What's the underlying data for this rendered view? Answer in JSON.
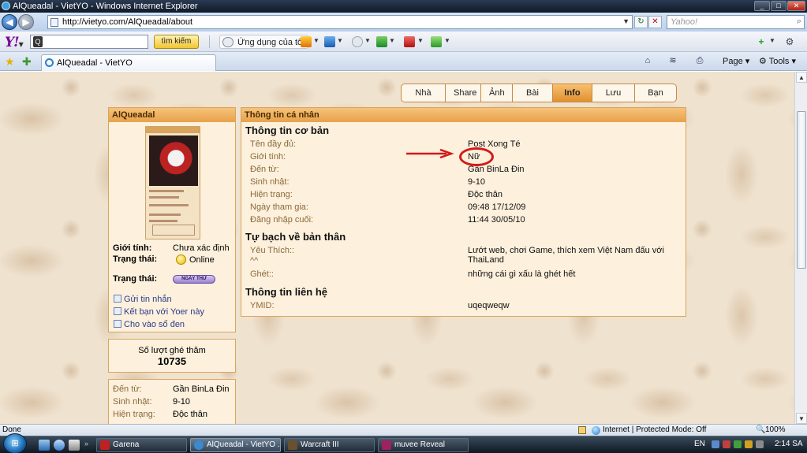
{
  "window": {
    "title": "AlQueadal - VietYO - Windows Internet Explorer"
  },
  "address": {
    "url": "http://vietyo.com/AlQueadal/about"
  },
  "search": {
    "placeholder": "Yahoo!"
  },
  "yahoo_toolbar": {
    "search_button": "tìm kiếm",
    "apps_label": "Ứng dụng của tôi"
  },
  "tab": {
    "title": "AlQueadal - VietYO"
  },
  "commands": {
    "page": "Page",
    "tools": "Tools"
  },
  "nav_tabs": [
    {
      "label": "Nhà",
      "active": false
    },
    {
      "label": "Share",
      "active": false
    },
    {
      "label": "Ảnh",
      "active": false
    },
    {
      "label": "Bài viết",
      "active": false
    },
    {
      "label": "Info",
      "active": true
    },
    {
      "label": "Lưu bút",
      "active": false
    },
    {
      "label": "Bạn bè",
      "active": false
    }
  ],
  "profile": {
    "username": "AlQueadal",
    "gender_label": "Giới tính:",
    "gender_value": "Chưa xác định",
    "status_label": "Trạng thái:",
    "status_value": "Online",
    "mood_label": "Trạng thái:",
    "mood_badge": "NGÀY THỨ",
    "links": [
      "Gửi tin nhắn",
      "Kết bạn với Yoer này",
      "Cho vào sổ đen"
    ]
  },
  "views": {
    "label": "Số lượt ghé thăm",
    "count": "10735"
  },
  "extra": [
    {
      "key": "Đến từ:",
      "value": "Gần BinLa Đin"
    },
    {
      "key": "Sinh nhật:",
      "value": "9-10"
    },
    {
      "key": "Hiện trạng:",
      "value": "Độc thân"
    }
  ],
  "info": {
    "header": "Thông tin cá nhân",
    "basic_title": "Thông tin cơ bản",
    "basic": [
      {
        "key": "Tên đầy đủ:",
        "value": "Post Xong Té"
      },
      {
        "key": "Giới tính:",
        "value": "Nữ"
      },
      {
        "key": "Đến từ:",
        "value": "Gần BinLa Đin"
      },
      {
        "key": "Sinh nhật:",
        "value": "9-10"
      },
      {
        "key": "Hiện trạng:",
        "value": "Độc thân"
      },
      {
        "key": "Ngày tham gia:",
        "value": "09:48 17/12/09"
      },
      {
        "key": "Đăng nhập cuối:",
        "value": "11:44 30/05/10"
      }
    ],
    "about_title": "Tự bạch về bản thân",
    "about": [
      {
        "key": "Yêu Thích::",
        "key2": "^^",
        "value": "Lướt web, chơi Game, thích xem Việt Nam đấu với ThaiLand"
      },
      {
        "key": "Ghét::",
        "value": "những cái gì xấu là ghét hết"
      }
    ],
    "contact_title": "Thông tin liên hệ",
    "contact": [
      {
        "key": "YMID:",
        "value": "uqeqweqw"
      }
    ]
  },
  "annotation": {
    "color": "#d21a1a"
  },
  "status": {
    "left": "Done",
    "zone": "Internet | Protected Mode: Off",
    "zoom": "100%"
  },
  "taskbar": {
    "tasks": [
      {
        "label": "Garena",
        "active": false
      },
      {
        "label": "AlQueadal - VietYO ...",
        "active": true
      },
      {
        "label": "Warcraft III",
        "active": false
      },
      {
        "label": "muvee Reveal",
        "active": false
      }
    ],
    "lang": "EN",
    "clock": "2:14 SA"
  },
  "colors": {
    "accent": "#e7a24a",
    "panel_bg": "#fdf0dc",
    "page_bg": "#efe2cf"
  }
}
